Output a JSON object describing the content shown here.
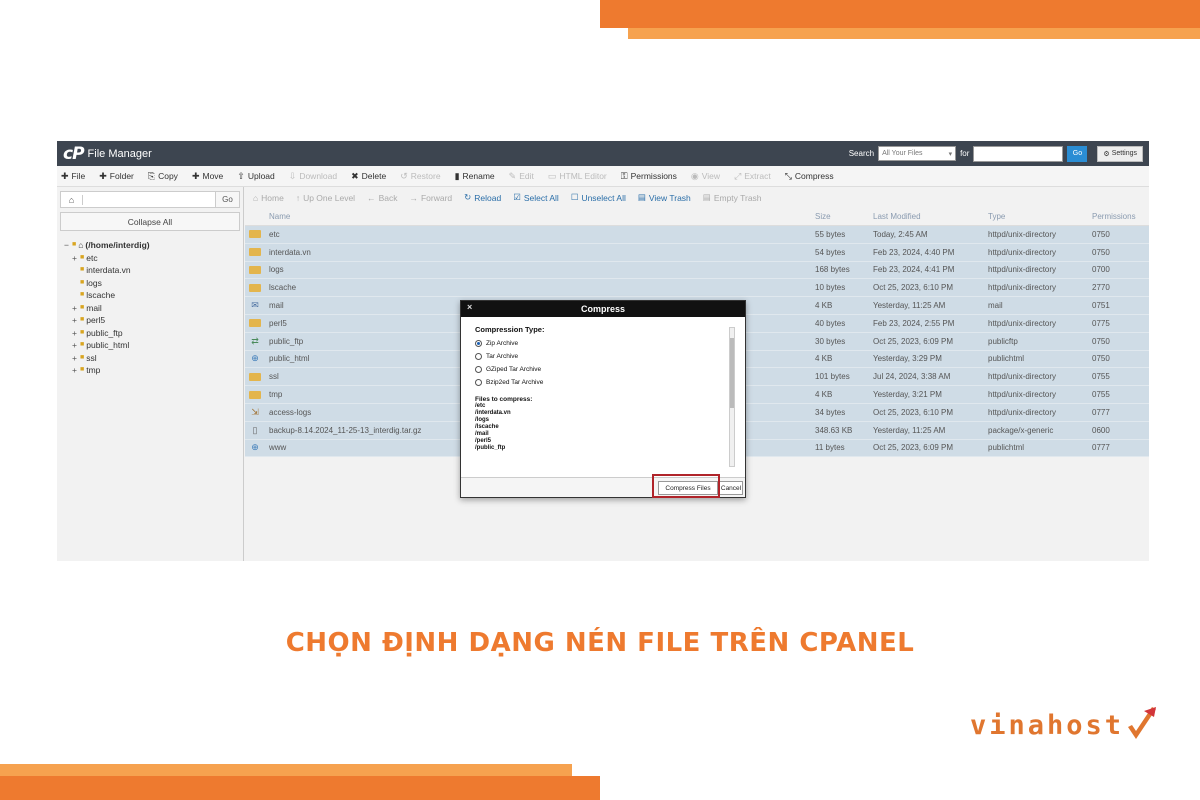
{
  "colors": {
    "accent": "#ee7a2f",
    "accent_light": "#f6a24f",
    "header_bg": "#3d4550",
    "highlight": "#b0242a"
  },
  "app": {
    "title": "File Manager",
    "logo_text": "cP"
  },
  "search": {
    "label": "Search",
    "scope": "All Your Files",
    "for_label": "for",
    "go": "Go",
    "settings": "Settings"
  },
  "toolbar": {
    "file": "File",
    "folder": "Folder",
    "copy": "Copy",
    "move": "Move",
    "upload": "Upload",
    "download": "Download",
    "delete": "Delete",
    "restore": "Restore",
    "rename": "Rename",
    "edit": "Edit",
    "html_editor": "HTML Editor",
    "permissions": "Permissions",
    "view": "View",
    "extract": "Extract",
    "compress": "Compress"
  },
  "left": {
    "go": "Go",
    "collapse_all": "Collapse All",
    "tree": [
      "(/home/interdig)",
      "etc",
      "interdata.vn",
      "logs",
      "lscache",
      "mail",
      "perl5",
      "public_ftp",
      "public_html",
      "ssl",
      "tmp"
    ]
  },
  "nav": {
    "home": "Home",
    "up": "Up One Level",
    "back": "Back",
    "forward": "Forward",
    "reload": "Reload",
    "select_all": "Select All",
    "unselect_all": "Unselect All",
    "view_trash": "View Trash",
    "empty_trash": "Empty Trash"
  },
  "table": {
    "headers": {
      "name": "Name",
      "size": "Size",
      "modified": "Last Modified",
      "type": "Type",
      "perm": "Permissions"
    },
    "rows": [
      {
        "name": "etc",
        "size": "55 bytes",
        "modified": "Today, 2:45 AM",
        "type": "httpd/unix-directory",
        "perm": "0750"
      },
      {
        "name": "interdata.vn",
        "size": "54 bytes",
        "modified": "Feb 23, 2024, 4:40 PM",
        "type": "httpd/unix-directory",
        "perm": "0750"
      },
      {
        "name": "logs",
        "size": "168 bytes",
        "modified": "Feb 23, 2024, 4:41 PM",
        "type": "httpd/unix-directory",
        "perm": "0700"
      },
      {
        "name": "lscache",
        "size": "10 bytes",
        "modified": "Oct 25, 2023, 6:10 PM",
        "type": "httpd/unix-directory",
        "perm": "2770"
      },
      {
        "name": "mail",
        "size": "4 KB",
        "modified": "Yesterday, 11:25 AM",
        "type": "mail",
        "perm": "0751"
      },
      {
        "name": "perl5",
        "size": "40 bytes",
        "modified": "Feb 23, 2024, 2:55 PM",
        "type": "httpd/unix-directory",
        "perm": "0775"
      },
      {
        "name": "public_ftp",
        "size": "30 bytes",
        "modified": "Oct 25, 2023, 6:09 PM",
        "type": "publicftp",
        "perm": "0750"
      },
      {
        "name": "public_html",
        "size": "4 KB",
        "modified": "Yesterday, 3:29 PM",
        "type": "publichtml",
        "perm": "0750"
      },
      {
        "name": "ssl",
        "size": "101 bytes",
        "modified": "Jul 24, 2024, 3:38 AM",
        "type": "httpd/unix-directory",
        "perm": "0755"
      },
      {
        "name": "tmp",
        "size": "4 KB",
        "modified": "Yesterday, 3:21 PM",
        "type": "httpd/unix-directory",
        "perm": "0755"
      },
      {
        "name": "access-logs",
        "size": "34 bytes",
        "modified": "Oct 25, 2023, 6:10 PM",
        "type": "httpd/unix-directory",
        "perm": "0777"
      },
      {
        "name": "backup-8.14.2024_11-25-13_interdig.tar.gz",
        "size": "348.63 KB",
        "modified": "Yesterday, 11:25 AM",
        "type": "package/x-generic",
        "perm": "0600"
      },
      {
        "name": "www",
        "size": "11 bytes",
        "modified": "Oct 25, 2023, 6:09 PM",
        "type": "publichtml",
        "perm": "0777"
      }
    ]
  },
  "modal": {
    "title": "Compress",
    "close": "×",
    "compression_type_label": "Compression Type:",
    "options": [
      "Zip Archive",
      "Tar Archive",
      "GZiped Tar Archive",
      "Bzip2ed Tar Archive"
    ],
    "selected": "Zip Archive",
    "files_label": "Files to compress:",
    "files": [
      "/etc",
      "/interdata.vn",
      "/logs",
      "/lscache",
      "/mail",
      "/perl5",
      "/public_ftp"
    ],
    "compress_button": "Compress Files",
    "cancel_button": "Cancel"
  },
  "caption": "CHỌN ĐỊNH DẠNG NÉN FILE TRÊN CPANEL",
  "brand": {
    "name": "vinahost"
  }
}
